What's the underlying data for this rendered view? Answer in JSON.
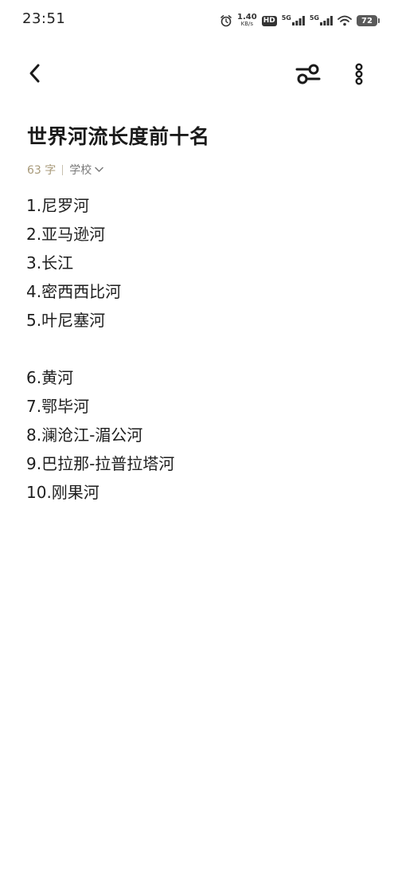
{
  "status_bar": {
    "time": "23:51",
    "net_speed_value": "1.40",
    "net_speed_unit": "KB/s",
    "hd_label": "HD",
    "sim1_label": "5G",
    "sim2_label": "5G",
    "battery_level": "72",
    "icons": [
      "alarm-icon",
      "hd-icon",
      "signal-icon",
      "signal-icon",
      "wifi-icon",
      "battery-icon"
    ]
  },
  "toolbar": {
    "back_icon": "chevron-left-icon",
    "filter_icon": "sliders-icon",
    "more_icon": "vertical-dots-icon"
  },
  "note": {
    "title": "世界河流长度前十名",
    "word_count": "63 字",
    "folder": "学校",
    "lines": [
      "1.尼罗河",
      "2.亚马逊河",
      "3.长江",
      "4.密西西比河",
      "5.叶尼塞河",
      "",
      "6.黄河",
      "7.鄂毕河",
      "8.澜沧江-湄公河",
      "9.巴拉那-拉普拉塔河",
      "10.刚果河"
    ]
  },
  "colors": {
    "meta_text": "#a89a7a",
    "background": "#ffffff",
    "text": "#1e1e1e"
  }
}
